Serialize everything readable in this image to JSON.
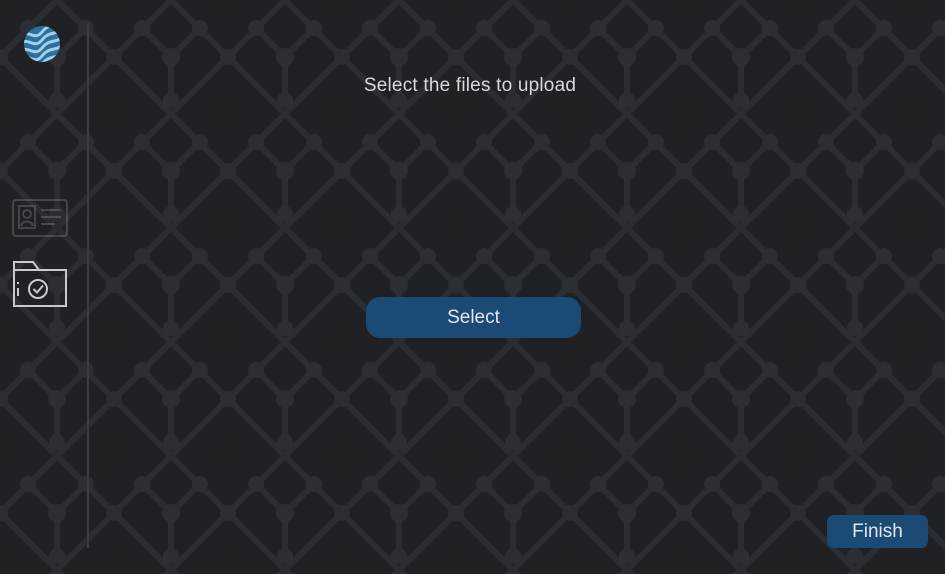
{
  "page": {
    "title": "Select the files to upload"
  },
  "actions": {
    "select_label": "Select",
    "finish_label": "Finish"
  },
  "sidebar": {
    "logo": "wave-logo-icon",
    "steps": [
      {
        "icon": "id-card-icon",
        "state": "inactive"
      },
      {
        "icon": "folder-check-icon",
        "state": "active"
      }
    ]
  },
  "colors": {
    "background": "#1f2124",
    "button": "#1b4a74",
    "logo": "#3f8fc4",
    "text": "#d7d8da"
  }
}
